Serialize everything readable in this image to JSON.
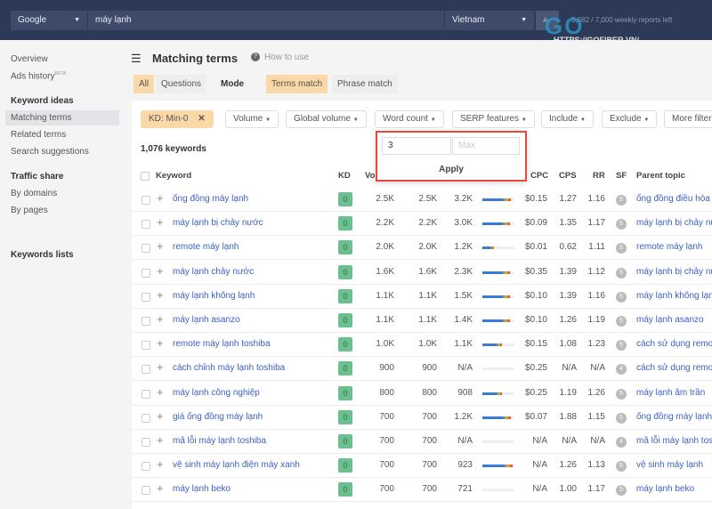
{
  "topbar": {
    "engine": "Google",
    "query": "máy lạnh",
    "country": "Vietnam",
    "reports_left": "5,682 / 7,000 weekly reports left",
    "watermark": "GOFIBER",
    "watermark_url": "HTTPS://GOFIBER.VN/"
  },
  "sidebar": {
    "items": [
      {
        "label": "Overview"
      },
      {
        "label": "Ads history",
        "badge": "BETA"
      },
      {
        "label": "Keyword ideas",
        "heading": true
      },
      {
        "label": "Matching terms",
        "active": true
      },
      {
        "label": "Related terms"
      },
      {
        "label": "Search suggestions"
      },
      {
        "label": "Traffic share",
        "heading": true
      },
      {
        "label": "By domains"
      },
      {
        "label": "By pages"
      },
      {
        "label": "Keywords lists",
        "heading": true
      }
    ]
  },
  "header": {
    "title": "Matching terms",
    "how_to": "How to use"
  },
  "tabs": {
    "all": "All",
    "questions": "Questions",
    "mode": "Mode",
    "terms_match": "Terms match",
    "phrase_match": "Phrase match"
  },
  "filters": {
    "kd": "KD: Min-0",
    "volume": "Volume",
    "global_volume": "Global volume",
    "word_count": "Word count",
    "serp": "SERP features",
    "include": "Include",
    "exclude": "Exclude",
    "more": "More filters"
  },
  "popup": {
    "min": "3",
    "max_placeholder": "Max",
    "apply": "Apply"
  },
  "count": "1,076 keywords",
  "columns": {
    "keyword": "Keyword",
    "kd": "KD",
    "volume": "Vo",
    "cpc": "CPC",
    "cps": "CPS",
    "rr": "RR",
    "sf": "SF",
    "parent": "Parent topic"
  },
  "rows": [
    {
      "kw": "ống đồng máy lạnh",
      "kd": "0",
      "vol": "2.5K",
      "gv": "2.5K",
      "tp": "3.2K",
      "bar": 0.9,
      "cpc": "$0.15",
      "cps": "1.27",
      "rr": "1.16",
      "sf": "5",
      "parent": "ống đồng điều hòa"
    },
    {
      "kw": "máy lạnh bị chảy nước",
      "kd": "0",
      "vol": "2.2K",
      "gv": "2.2K",
      "tp": "3.0K",
      "bar": 0.85,
      "cpc": "$0.09",
      "cps": "1.35",
      "rr": "1.17",
      "sf": "5",
      "parent": "máy lạnh bị chảy nước"
    },
    {
      "kw": "remote máy lạnh",
      "kd": "0",
      "vol": "2.0K",
      "gv": "2.0K",
      "tp": "1.2K",
      "bar": 0.35,
      "cpc": "$0.01",
      "cps": "0.62",
      "rr": "1.11",
      "sf": "5",
      "parent": "remote máy lạnh"
    },
    {
      "kw": "máy lạnh chảy nước",
      "kd": "0",
      "vol": "1.6K",
      "gv": "1.6K",
      "tp": "2.3K",
      "bar": 0.85,
      "cpc": "$0.35",
      "cps": "1.39",
      "rr": "1.12",
      "sf": "5",
      "parent": "máy lạnh bị chảy nước"
    },
    {
      "kw": "máy lạnh không lạnh",
      "kd": "0",
      "vol": "1.1K",
      "gv": "1.1K",
      "tp": "1.5K",
      "bar": 0.85,
      "cpc": "$0.10",
      "cps": "1.39",
      "rr": "1.16",
      "sf": "5",
      "parent": "máy lạnh không lạnh"
    },
    {
      "kw": "máy lạnh asanzo",
      "kd": "0",
      "vol": "1.1K",
      "gv": "1.1K",
      "tp": "1.4K",
      "bar": 0.85,
      "cpc": "$0.10",
      "cps": "1.26",
      "rr": "1.19",
      "sf": "5",
      "parent": "máy lạnh asanzo"
    },
    {
      "kw": "remote máy lạnh toshiba",
      "kd": "0",
      "vol": "1.0K",
      "gv": "1.0K",
      "tp": "1.1K",
      "bar": 0.6,
      "cpc": "$0.15",
      "cps": "1.08",
      "rr": "1.23",
      "sf": "5",
      "parent": "cách sử dụng remote"
    },
    {
      "kw": "cách chỉnh máy lạnh toshiba",
      "kd": "0",
      "vol": "900",
      "gv": "900",
      "tp": "N/A",
      "bar": 0,
      "cpc": "$0.25",
      "cps": "N/A",
      "rr": "N/A",
      "sf": "4",
      "parent": "cách sử dụng remote"
    },
    {
      "kw": "máy lạnh công nghiệp",
      "kd": "0",
      "vol": "800",
      "gv": "800",
      "tp": "908",
      "bar": 0.6,
      "cpc": "$0.25",
      "cps": "1.19",
      "rr": "1.26",
      "sf": "5",
      "parent": "máy lạnh âm trần"
    },
    {
      "kw": "giá ống đồng máy lạnh",
      "kd": "0",
      "vol": "700",
      "gv": "700",
      "tp": "1.2K",
      "bar": 0.9,
      "cpc": "$0.07",
      "cps": "1.88",
      "rr": "1.15",
      "sf": "5",
      "parent": "ống đồng máy lạnh"
    },
    {
      "kw": "mã lỗi máy lạnh toshiba",
      "kd": "0",
      "vol": "700",
      "gv": "700",
      "tp": "N/A",
      "bar": 0,
      "cpc": "N/A",
      "cps": "N/A",
      "rr": "N/A",
      "sf": "4",
      "parent": "mã lỗi máy lạnh toshiba"
    },
    {
      "kw": "vệ sinh máy lạnh điện máy xanh",
      "kd": "0",
      "vol": "700",
      "gv": "700",
      "tp": "923",
      "bar": 0.95,
      "cpc": "N/A",
      "cps": "1.26",
      "rr": "1.13",
      "sf": "5",
      "parent": "vệ sinh máy lạnh"
    },
    {
      "kw": "máy lạnh beko",
      "kd": "0",
      "vol": "700",
      "gv": "700",
      "tp": "721",
      "bar": 0,
      "cpc": "N/A",
      "cps": "1.00",
      "rr": "1.17",
      "sf": "5",
      "parent": "máy lạnh beko"
    }
  ]
}
